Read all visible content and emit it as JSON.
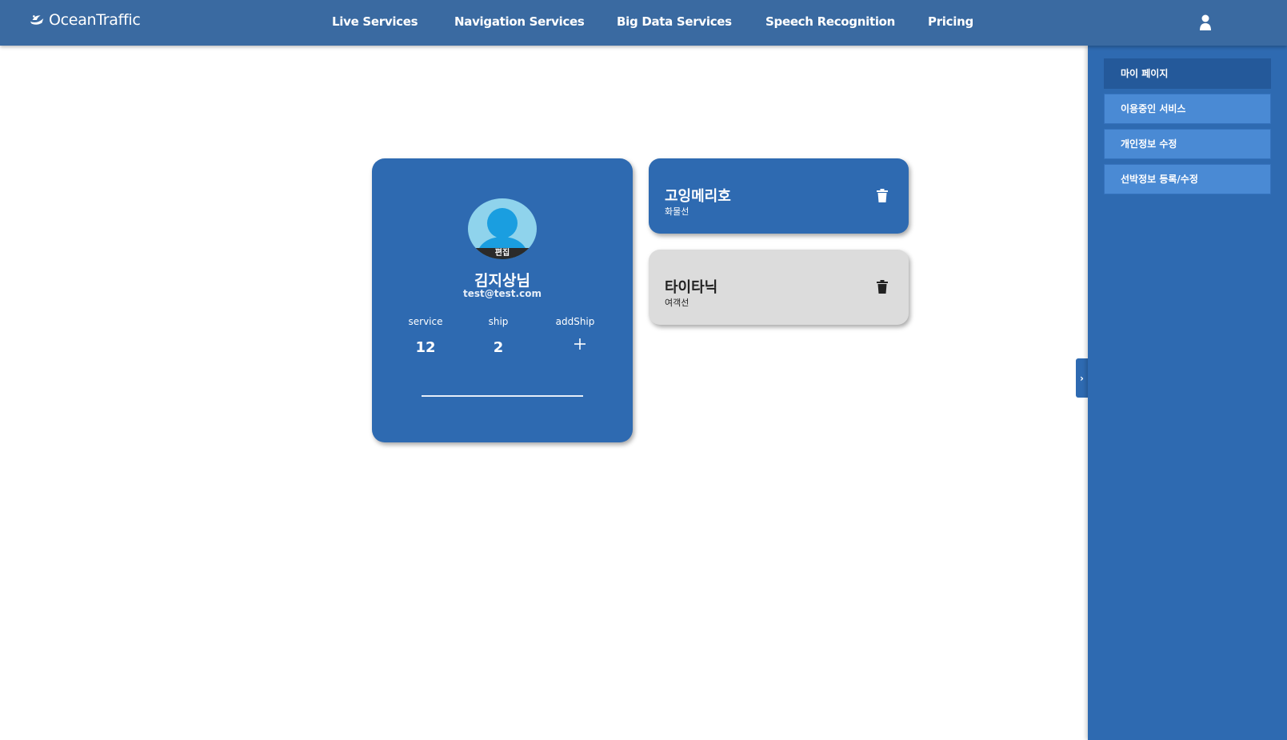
{
  "header": {
    "brand": "OceanTraffic",
    "nav": [
      "Live Services",
      "Navigation Services",
      "Big Data Services",
      "Speech Recognition",
      "Pricing"
    ]
  },
  "sidebar": {
    "items": [
      {
        "label": "마이 페이지",
        "active": true
      },
      {
        "label": "이용중인 서비스",
        "active": false
      },
      {
        "label": "개인정보 수정",
        "active": false
      },
      {
        "label": "선박정보 등록/수정",
        "active": false
      }
    ],
    "toggle_glyph": "›"
  },
  "profile": {
    "edit_label": "편집",
    "name": "김지상님",
    "email": "test@test.com",
    "stats": [
      {
        "label": "service",
        "value": "12"
      },
      {
        "label": "ship",
        "value": "2"
      },
      {
        "label": "addShip",
        "value": ""
      }
    ]
  },
  "ships": [
    {
      "name": "고잉메리호",
      "type": "화물선",
      "theme": "blue"
    },
    {
      "name": "타이타닉",
      "type": "여객선",
      "theme": "gray"
    }
  ],
  "colors": {
    "header_bg": "#3a6aa1",
    "sidebar_bg": "#2e6ab1",
    "sidebar_item": "#4a8ad4",
    "sidebar_item_active": "#24599a",
    "card_blue": "#2e6ab1",
    "card_gray": "#dcdcdc"
  }
}
